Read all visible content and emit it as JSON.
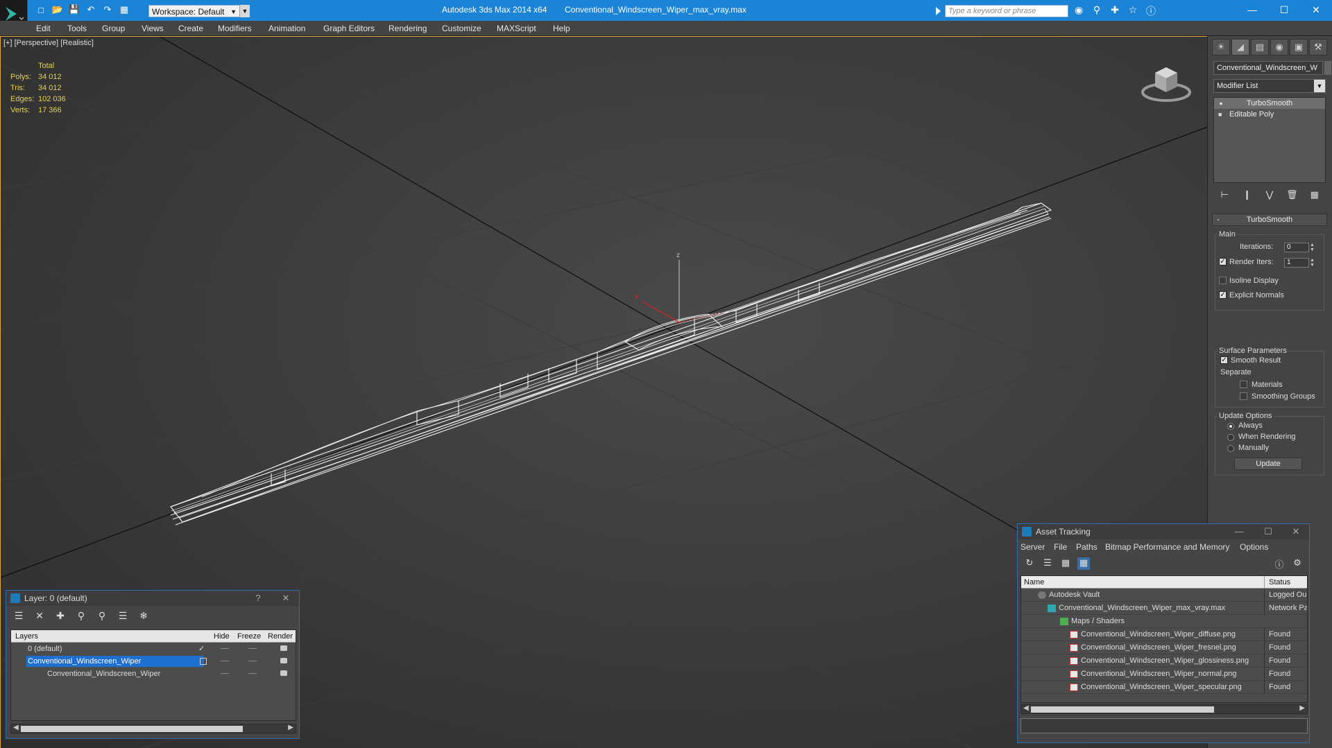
{
  "titlebar": {
    "workspace": "Workspace: Default",
    "app_title": "Autodesk 3ds Max  2014 x64",
    "file_title": "Conventional_Windscreen_Wiper_max_vray.max",
    "search_placeholder": "Type a keyword or phrase"
  },
  "menu": [
    "Edit",
    "Tools",
    "Group",
    "Views",
    "Create",
    "Modifiers",
    "Animation",
    "Graph Editors",
    "Rendering",
    "Customize",
    "MAXScript",
    "Help"
  ],
  "viewport": {
    "label": "[+] [Perspective] [Realistic]",
    "stats": {
      "total_label": "Total",
      "polys_label": "Polys:",
      "polys": "34 012",
      "tris_label": "Tris:",
      "tris": "34 012",
      "edges_label": "Edges:",
      "edges": "102 036",
      "verts_label": "Verts:",
      "verts": "17 366"
    },
    "axis_z": "z",
    "axis_x": "x"
  },
  "command_panel": {
    "object_name": "Conventional_Windscreen_W",
    "modifier_list": "Modifier List",
    "stack": [
      "TurboSmooth",
      "Editable Poly"
    ],
    "rollout_title": "TurboSmooth",
    "main_label": "Main",
    "iterations_label": "Iterations:",
    "iterations": "0",
    "render_iters_label": "Render Iters:",
    "render_iters": "1",
    "isoline_label": "Isoline Display",
    "explicit_normals_label": "Explicit Normals",
    "surface_params_label": "Surface Parameters",
    "smooth_result_label": "Smooth Result",
    "separate_label": "Separate",
    "materials_label": "Materials",
    "smoothing_groups_label": "Smoothing Groups",
    "update_options_label": "Update Options",
    "always_label": "Always",
    "when_rendering_label": "When Rendering",
    "manually_label": "Manually",
    "update_button": "Update"
  },
  "layer_window": {
    "title": "Layer: 0 (default)",
    "help": "?",
    "columns": {
      "layers": "Layers",
      "hide": "Hide",
      "freeze": "Freeze",
      "render": "Render"
    },
    "rows": [
      {
        "name": "0 (default)"
      },
      {
        "name": "Conventional_Windscreen_Wiper"
      },
      {
        "name": "Conventional_Windscreen_Wiper"
      }
    ]
  },
  "asset_window": {
    "title": "Asset Tracking",
    "menu": [
      "Server",
      "File",
      "Paths",
      "Bitmap Performance and Memory",
      "Options"
    ],
    "columns": {
      "name": "Name",
      "status": "Status"
    },
    "rows": [
      {
        "name": "Autodesk Vault",
        "status": "Logged Ou"
      },
      {
        "name": "Conventional_Windscreen_Wiper_max_vray.max",
        "status": "Network Pa"
      },
      {
        "name": "Maps / Shaders",
        "status": ""
      },
      {
        "name": "Conventional_Windscreen_Wiper_diffuse.png",
        "status": "Found"
      },
      {
        "name": "Conventional_Windscreen_Wiper_fresnel.png",
        "status": "Found"
      },
      {
        "name": "Conventional_Windscreen_Wiper_glossiness.png",
        "status": "Found"
      },
      {
        "name": "Conventional_Windscreen_Wiper_normal.png",
        "status": "Found"
      },
      {
        "name": "Conventional_Windscreen_Wiper_specular.png",
        "status": "Found"
      }
    ]
  },
  "colors": {
    "titlebar": "#1c84d6",
    "selection": "#1f6fcf",
    "stats": "#e7d34b",
    "viewport_border": "#e0a83a"
  }
}
